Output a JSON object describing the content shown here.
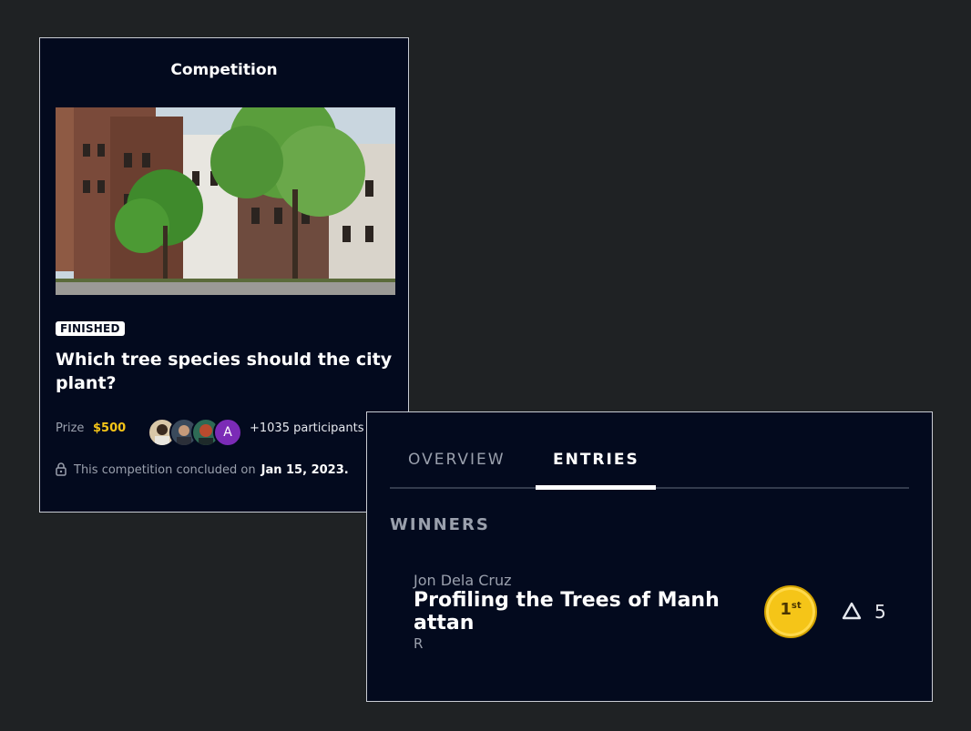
{
  "competition_card": {
    "title": "Competition",
    "status_badge": "FINISHED",
    "question": "Which tree species should the city plant?",
    "prize_label": "Prize",
    "prize_value": "$500",
    "avatar_initial": "A",
    "participants_text": "+1035 participants",
    "concluded_text": "This competition concluded on",
    "concluded_date": "Jan 15, 2023.",
    "colors": {
      "background": "#030a1e",
      "prize": "#f5c518",
      "avatar_purple": "#7b2bb6"
    }
  },
  "entries_card": {
    "tabs": [
      {
        "label": "OVERVIEW",
        "active": false
      },
      {
        "label": "ENTRIES",
        "active": true
      }
    ],
    "section_title": "WINNERS",
    "entry": {
      "author": "Jon Dela Cruz",
      "title": "Profiling the Trees of Manhattan",
      "suffix": "R",
      "medal": {
        "rank": "1",
        "suffix": "st"
      },
      "vote_icon": "triangle-upvote-icon",
      "votes": "5"
    }
  }
}
